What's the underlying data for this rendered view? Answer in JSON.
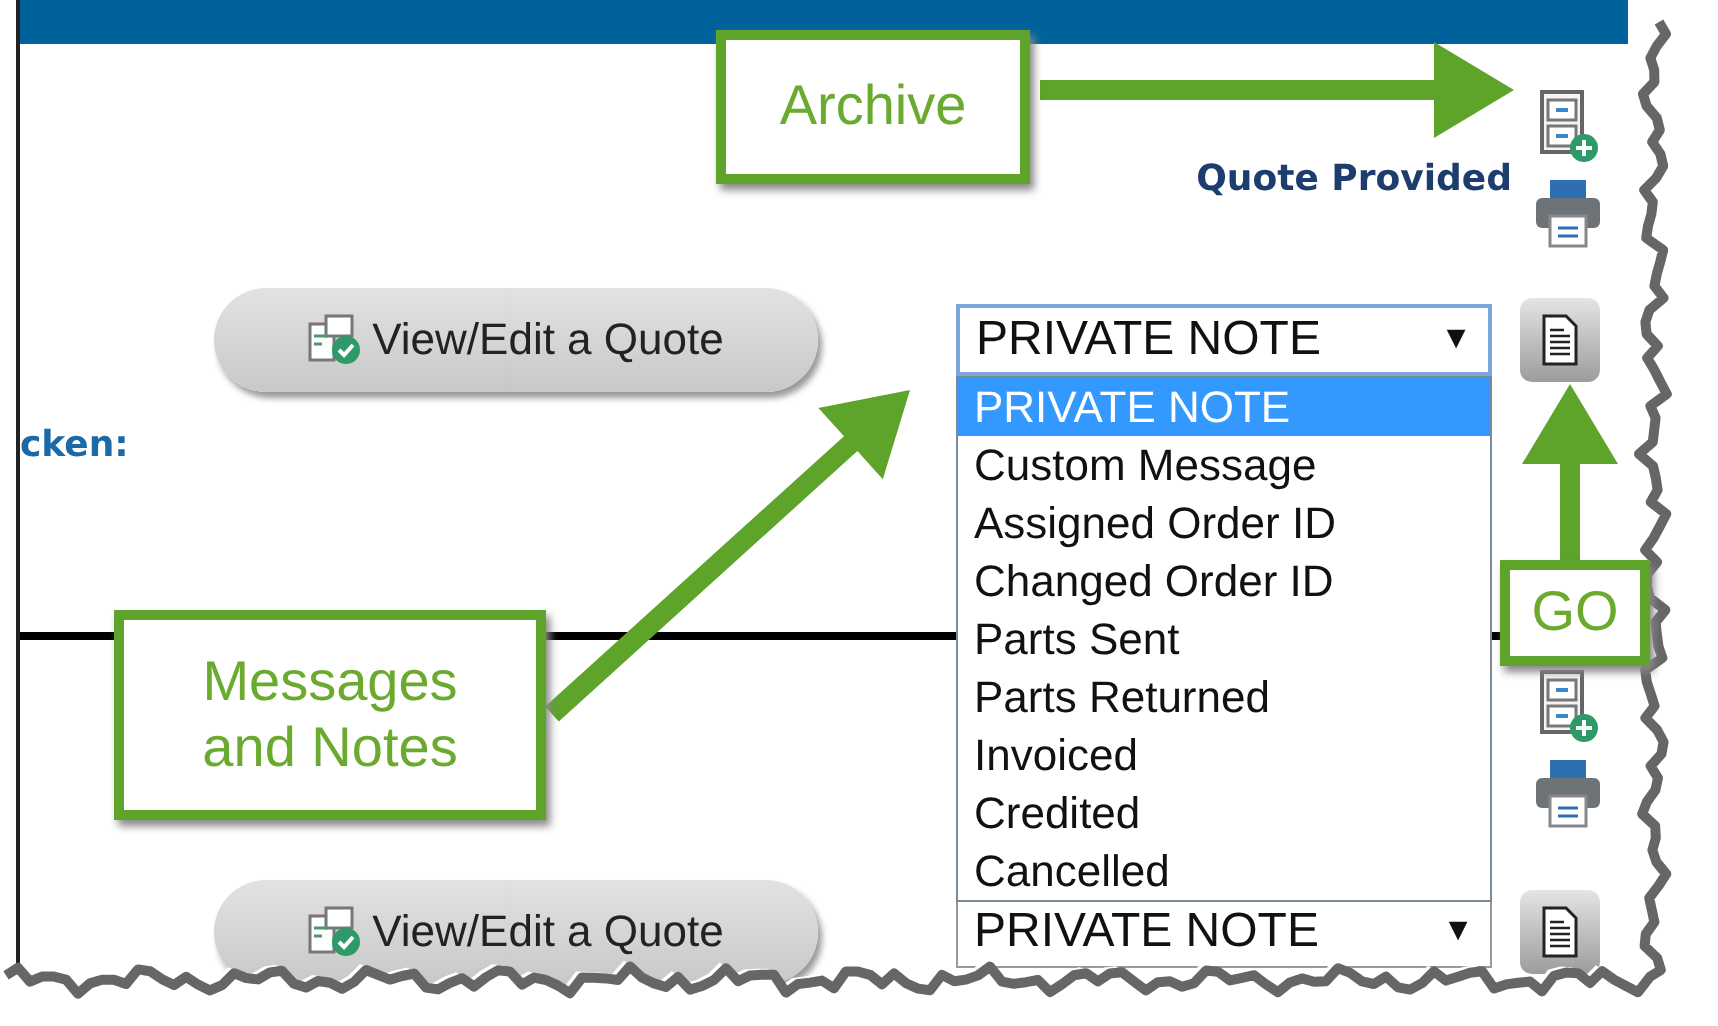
{
  "quotes": [
    {
      "status": "Quote Provided",
      "edit_button": "View/Edit a Quote",
      "label": "cken:",
      "note_select": {
        "value": "PRIVATE NOTE",
        "arrow": "▼",
        "expanded": true,
        "options": [
          {
            "label": "PRIVATE NOTE",
            "selected": true
          },
          {
            "label": "Custom Message",
            "selected": false
          },
          {
            "label": "Assigned Order ID",
            "selected": false
          },
          {
            "label": "Changed Order ID",
            "selected": false
          },
          {
            "label": "Parts Sent",
            "selected": false
          },
          {
            "label": "Parts Returned",
            "selected": false
          },
          {
            "label": "Invoiced",
            "selected": false
          },
          {
            "label": "Credited",
            "selected": false
          },
          {
            "label": "Cancelled",
            "selected": false
          }
        ]
      }
    },
    {
      "edit_button": "View/Edit a Quote",
      "note_select": {
        "value": "PRIVATE NOTE",
        "arrow": "▼",
        "expanded": false
      }
    }
  ],
  "annotations": [
    {
      "text": "Archive"
    },
    {
      "text": "GO"
    },
    {
      "text": "Messages and Notes"
    }
  ]
}
